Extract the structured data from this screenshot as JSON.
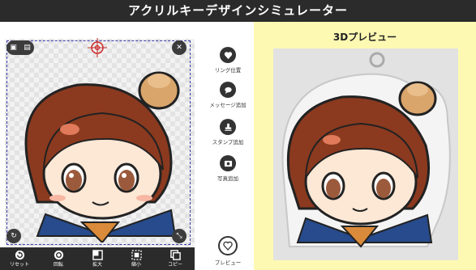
{
  "header": {
    "title": "アクリルキーデザインシミュレーター"
  },
  "toolbar": {
    "items": [
      {
        "label": "リセット",
        "icon": "reset-icon"
      },
      {
        "label": "回転",
        "icon": "rotate-icon"
      },
      {
        "label": "拡大",
        "icon": "zoom-in-icon"
      },
      {
        "label": "縮小",
        "icon": "zoom-out-icon"
      },
      {
        "label": "コピー",
        "icon": "copy-icon"
      }
    ]
  },
  "side": {
    "ring_position": "リング位置",
    "add_message": "メッセージ追加",
    "add_stamp": "スタンプ追加",
    "add_photo": "写真追加",
    "preview": "プレビュー"
  },
  "preview": {
    "title": "3Dプレビュー"
  },
  "colors": {
    "header_bg": "#2b2b2b",
    "preview_bg": "#fdf9b2",
    "selection": "#3a3aa8"
  }
}
